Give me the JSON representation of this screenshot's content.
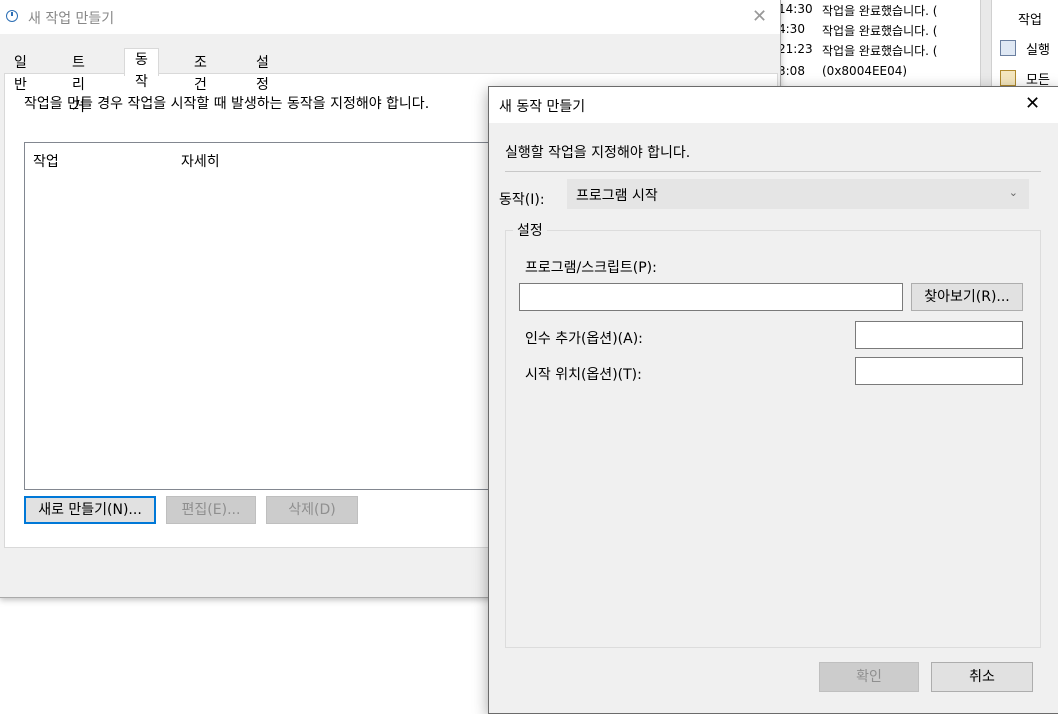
{
  "background_log": {
    "rows": [
      {
        "time": "14:30",
        "message": "작업을 완료했습니다. ("
      },
      {
        "time": "4:30",
        "message": "작업을 완료했습니다. ("
      },
      {
        "time": "21:23",
        "message": "작업을 완료했습니다. ("
      },
      {
        "time": "3:08",
        "message": "(0x8004EE04)"
      }
    ]
  },
  "background_actions": {
    "items": [
      {
        "label": "작업",
        "icon": "none"
      },
      {
        "label": "실행",
        "icon": "run-icon"
      },
      {
        "label": "모든",
        "icon": "task-icon"
      }
    ]
  },
  "create_task": {
    "title": "새 작업 만들기",
    "tabs": [
      "일반",
      "트리거",
      "동작",
      "조건",
      "설정"
    ],
    "active_tab": "동작",
    "description": "작업을 만들 경우 작업을 시작할 때 발생하는 동작을 지정해야 합니다.",
    "columns": [
      "작업",
      "자세히"
    ],
    "buttons": {
      "new": "새로 만들기(N)...",
      "edit": "편집(E)...",
      "delete": "삭제(D)"
    }
  },
  "new_action": {
    "title": "새 동작 만들기",
    "instruction": "실행할 작업을 지정해야 합니다.",
    "action_label": "동작(I):",
    "action_value": "프로그램 시작",
    "settings_legend": "설정",
    "program_label": "프로그램/스크립트(P):",
    "program_value": "",
    "browse_button": "찾아보기(R)...",
    "arguments_label": "인수 추가(옵션)(A):",
    "arguments_value": "",
    "start_in_label": "시작 위치(옵션)(T):",
    "start_in_value": "",
    "ok_button": "확인",
    "cancel_button": "취소"
  },
  "colors": {
    "accent": "#0078d7",
    "dialog_bg": "#f0f0f0",
    "disabled_text": "#8f8f8f"
  }
}
